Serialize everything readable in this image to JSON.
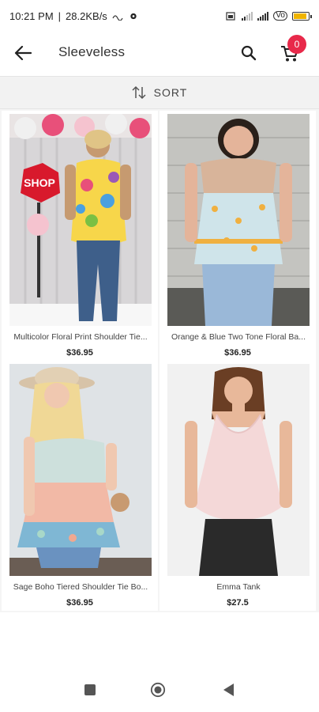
{
  "status_bar": {
    "time": "10:21 PM",
    "network_speed": "28.2KB/s",
    "volte": "Vo"
  },
  "header": {
    "title": "Sleeveless",
    "cart_count": "0"
  },
  "sort": {
    "label": "SORT"
  },
  "products": [
    {
      "name": "Multicolor Floral Print Shoulder Tie...",
      "price": "$36.95",
      "photo_sign": "SHOP"
    },
    {
      "name": "Orange & Blue Two Tone Floral Ba...",
      "price": "$36.95"
    },
    {
      "name": "Sage Boho Tiered Shoulder Tie Bo...",
      "price": "$36.95"
    },
    {
      "name": "Emma Tank",
      "price": "$27.5"
    }
  ],
  "colors": {
    "accent": "#e8294a",
    "sort_bg": "#f2f2f2",
    "text": "#333333"
  },
  "icons": {
    "back": "arrow-left-icon",
    "search": "search-icon",
    "cart": "shopping-cart-icon",
    "sort": "sort-arrows-icon",
    "nav_recents": "square-icon",
    "nav_home": "circle-icon",
    "nav_back": "triangle-back-icon"
  }
}
